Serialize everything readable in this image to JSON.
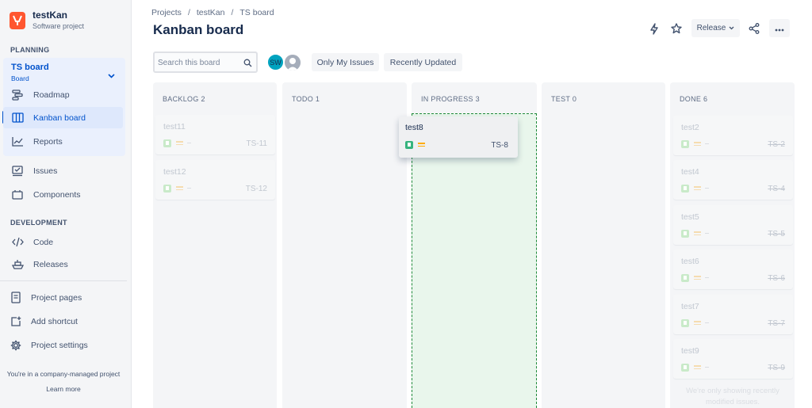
{
  "project": {
    "name": "testKan",
    "type": "Software project"
  },
  "sidebar": {
    "planning_heading": "PLANNING",
    "board": {
      "title": "TS board",
      "subtitle": "Board"
    },
    "planning_items": [
      {
        "label": "Roadmap",
        "icon": "roadmap-icon"
      },
      {
        "label": "Kanban board",
        "icon": "board-columns-icon",
        "active": true
      },
      {
        "label": "Reports",
        "icon": "chart-line-icon"
      }
    ],
    "items": [
      {
        "label": "Issues",
        "icon": "issues-icon"
      },
      {
        "label": "Components",
        "icon": "components-icon"
      }
    ],
    "development_heading": "DEVELOPMENT",
    "development_items": [
      {
        "label": "Code",
        "icon": "code-icon"
      },
      {
        "label": "Releases",
        "icon": "ship-icon"
      }
    ],
    "bottom_items": [
      {
        "label": "Project pages",
        "icon": "page-icon"
      },
      {
        "label": "Add shortcut",
        "icon": "add-shortcut-icon"
      },
      {
        "label": "Project settings",
        "icon": "gear-icon"
      }
    ],
    "footer_text": "You're in a company-managed project",
    "learn_more": "Learn more"
  },
  "breadcrumb": [
    "Projects",
    "testKan",
    "TS board"
  ],
  "page_title": "Kanban board",
  "header": {
    "release_label": "Release"
  },
  "toolbar": {
    "search_placeholder": "Search this board",
    "avatar_initials": "SW",
    "filters": [
      "Only My Issues",
      "Recently Updated"
    ]
  },
  "columns": [
    {
      "name": "BACKLOG",
      "count": "2",
      "cards": [
        {
          "title": "test11",
          "key": "TS-11"
        },
        {
          "title": "test12",
          "key": "TS-12"
        }
      ]
    },
    {
      "name": "TODO",
      "count": "1",
      "cards": []
    },
    {
      "name": "IN PROGRESS",
      "count": "3",
      "cards": []
    },
    {
      "name": "TEST",
      "count": "0",
      "cards": []
    },
    {
      "name": "DONE",
      "count": "6",
      "cards": [
        {
          "title": "test2",
          "key": "TS-2"
        },
        {
          "title": "test4",
          "key": "TS-4"
        },
        {
          "title": "test5",
          "key": "TS-5"
        },
        {
          "title": "test6",
          "key": "TS-6"
        },
        {
          "title": "test7",
          "key": "TS-7"
        },
        {
          "title": "test9",
          "key": "TS-9"
        }
      ],
      "note": "We're only showing recently modified issues."
    }
  ],
  "dragging_card": {
    "title": "test8",
    "key": "TS-8"
  },
  "colors": {
    "accent": "#0052CC",
    "drop_zone": "#E9F6EC",
    "drop_border": "#1F8A3A",
    "story": "#36B37E",
    "priority": "#FFAB00"
  }
}
